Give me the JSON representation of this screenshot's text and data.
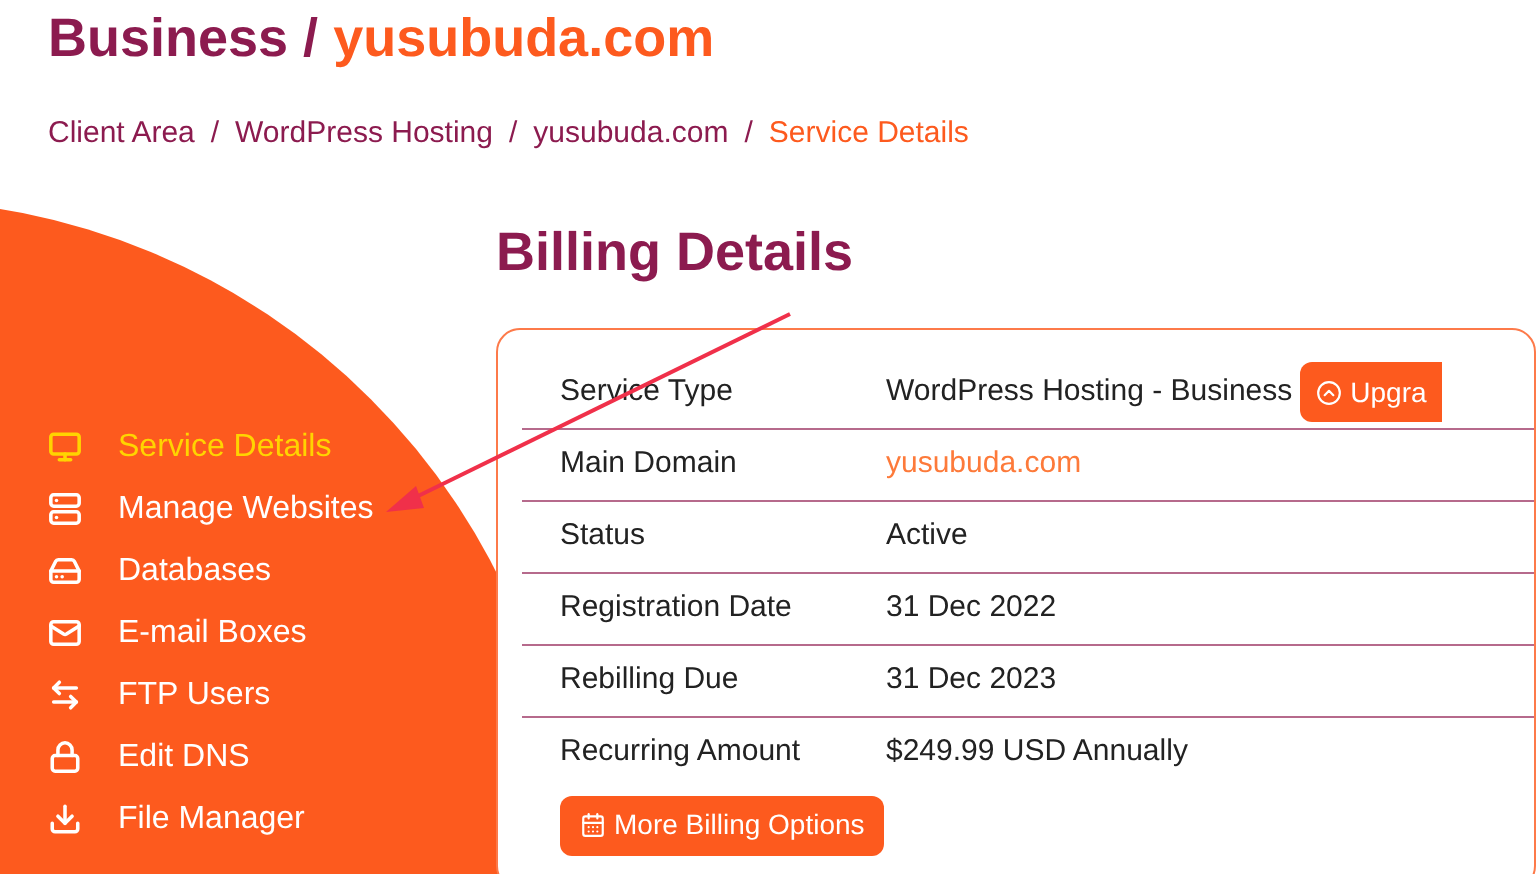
{
  "title": {
    "prefix": "Business / ",
    "domain": "yusubuda.com"
  },
  "breadcrumb": [
    {
      "label": "Client Area",
      "current": false
    },
    {
      "label": "WordPress Hosting",
      "current": false
    },
    {
      "label": "yusubuda.com",
      "current": false
    },
    {
      "label": "Service Details",
      "current": true
    }
  ],
  "breadcrumb_separator": "/",
  "sidebar": {
    "items": [
      {
        "label": "Service Details",
        "selected": true
      },
      {
        "label": "Manage Websites",
        "selected": false
      },
      {
        "label": "Databases",
        "selected": false
      },
      {
        "label": "E-mail Boxes",
        "selected": false
      },
      {
        "label": "FTP Users",
        "selected": false
      },
      {
        "label": "Edit DNS",
        "selected": false
      },
      {
        "label": "File Manager",
        "selected": false
      }
    ]
  },
  "billing": {
    "heading": "Billing Details",
    "rows": [
      {
        "label": "Service Type",
        "value": "WordPress Hosting - Business",
        "kind": "text",
        "button": "Upgra"
      },
      {
        "label": "Main Domain",
        "value": "yusubuda.com",
        "kind": "link"
      },
      {
        "label": "Status",
        "value": "Active",
        "kind": "text"
      },
      {
        "label": "Registration Date",
        "value": "31 Dec 2022",
        "kind": "text"
      },
      {
        "label": "Rebilling Due",
        "value": "31 Dec 2023",
        "kind": "text"
      },
      {
        "label": "Recurring Amount",
        "value": "$249.99 USD Annually",
        "kind": "text"
      }
    ],
    "more_button": "More Billing Options"
  },
  "annotation": {
    "kind": "arrow"
  }
}
